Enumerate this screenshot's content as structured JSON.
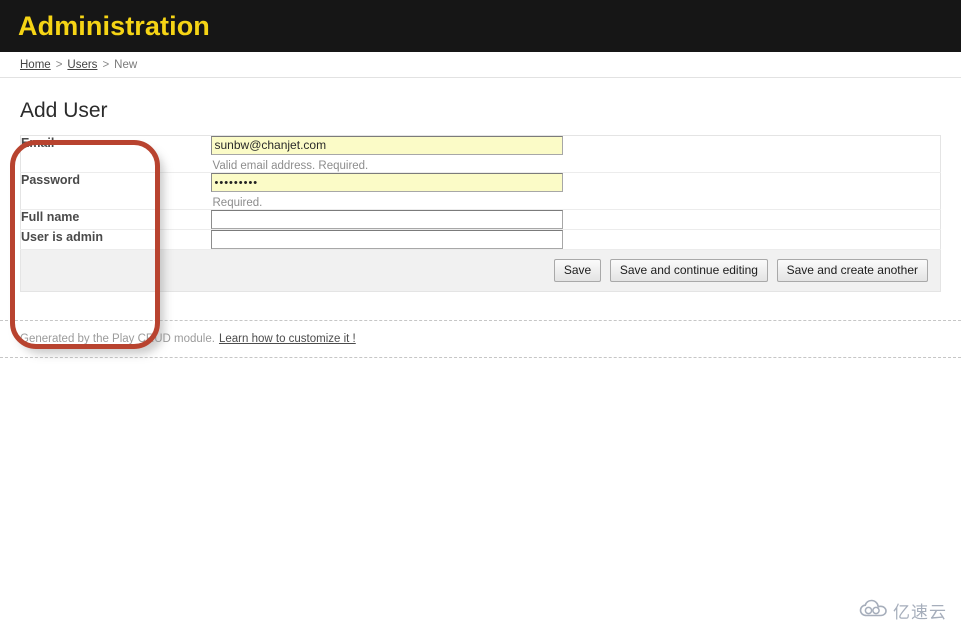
{
  "header": {
    "title": "Administration"
  },
  "breadcrumb": {
    "home": "Home",
    "separator1": ">",
    "users": "Users",
    "separator2": ">",
    "current": "New"
  },
  "page": {
    "heading": "Add User"
  },
  "form": {
    "rows": [
      {
        "label": "Email",
        "value": "sunbw@chanjet.com",
        "help": "Valid email address. Required.",
        "autofilled": true,
        "type": "email"
      },
      {
        "label": "Password",
        "value": "•••••••••",
        "help": "Required.",
        "autofilled": true,
        "type": "password"
      },
      {
        "label": "Full name",
        "value": "",
        "help": "",
        "autofilled": false,
        "type": "text"
      },
      {
        "label": "User is admin",
        "value": "",
        "help": "",
        "autofilled": false,
        "type": "text"
      }
    ],
    "buttons": [
      {
        "label": "Save"
      },
      {
        "label": "Save and continue editing"
      },
      {
        "label": "Save and create another"
      }
    ]
  },
  "annotation": {
    "color": "#b8432f",
    "shape": "rounded-rectangle"
  },
  "footer": {
    "text": "Generated by the Play CRUD module.",
    "link": "Learn how to customize it !"
  },
  "watermark": {
    "text": "亿速云",
    "icon": "cloud-icon"
  },
  "colors": {
    "header_background": "#161616",
    "header_title": "#f5d415",
    "autofill_background": "#fbfbc7",
    "button_bar_background": "#f1f1f1",
    "annotation": "#b8432f"
  }
}
